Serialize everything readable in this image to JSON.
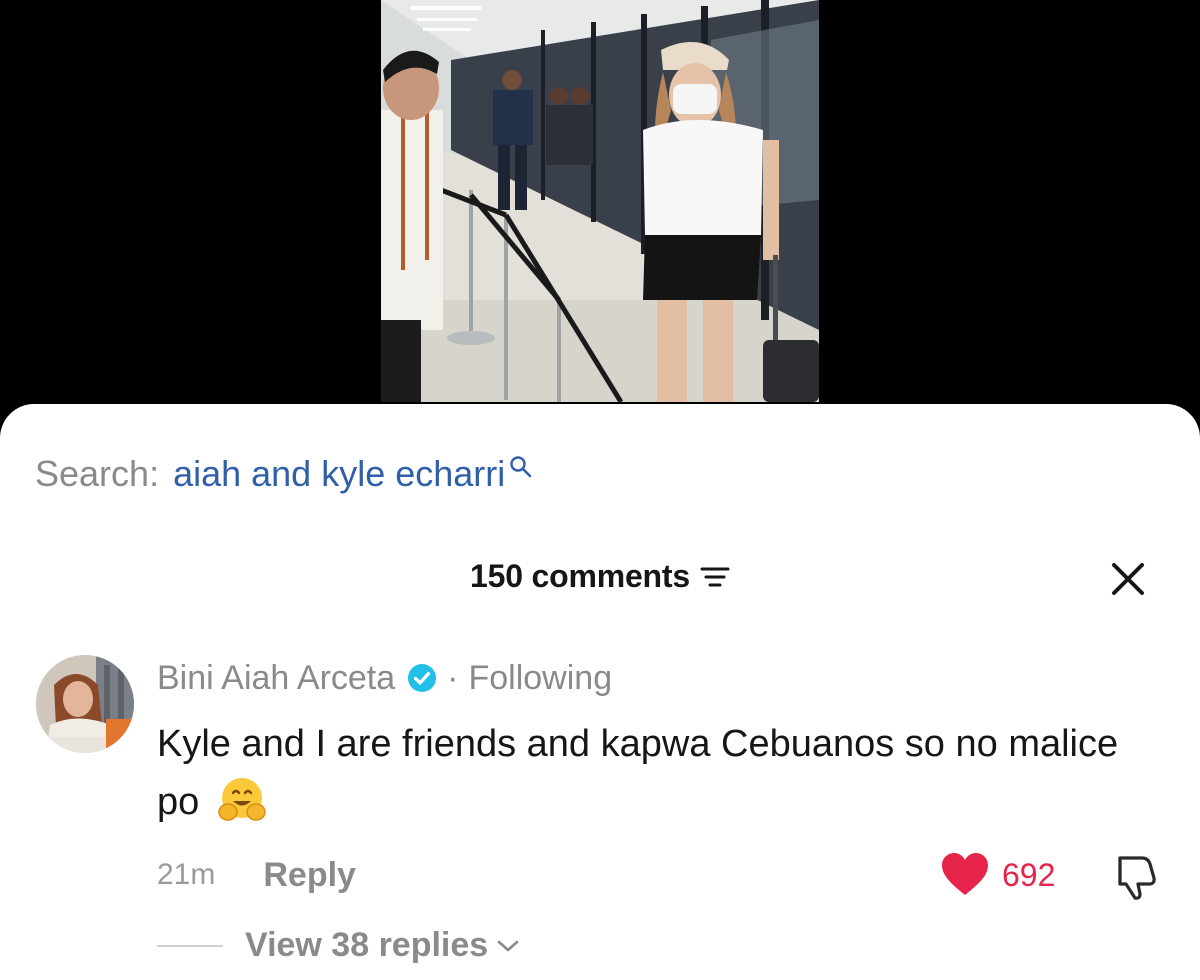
{
  "search": {
    "prefix": "Search:",
    "query": "aiah and kyle echarri"
  },
  "comments_panel": {
    "count_label": "150 comments"
  },
  "comment": {
    "author": "Bini Aiah Arceta",
    "separator": "·",
    "relationship": "Following",
    "text": "Kyle and I are friends and kapwa Cebuanos so no malice po",
    "emoji": "hugging-face",
    "time": "21m",
    "reply_label": "Reply",
    "like_count": "692",
    "view_replies_label": "View 38 replies"
  },
  "colors": {
    "link_blue": "#2f5fa8",
    "like_red": "#e6244a",
    "verified_blue": "#20c0e8",
    "muted_gray": "#8a8a8a"
  },
  "icons": [
    "search-icon",
    "sort-icon",
    "close-icon",
    "verified-icon",
    "hugging-face-emoji",
    "heart-icon",
    "dislike-icon",
    "chevron-down-icon"
  ]
}
